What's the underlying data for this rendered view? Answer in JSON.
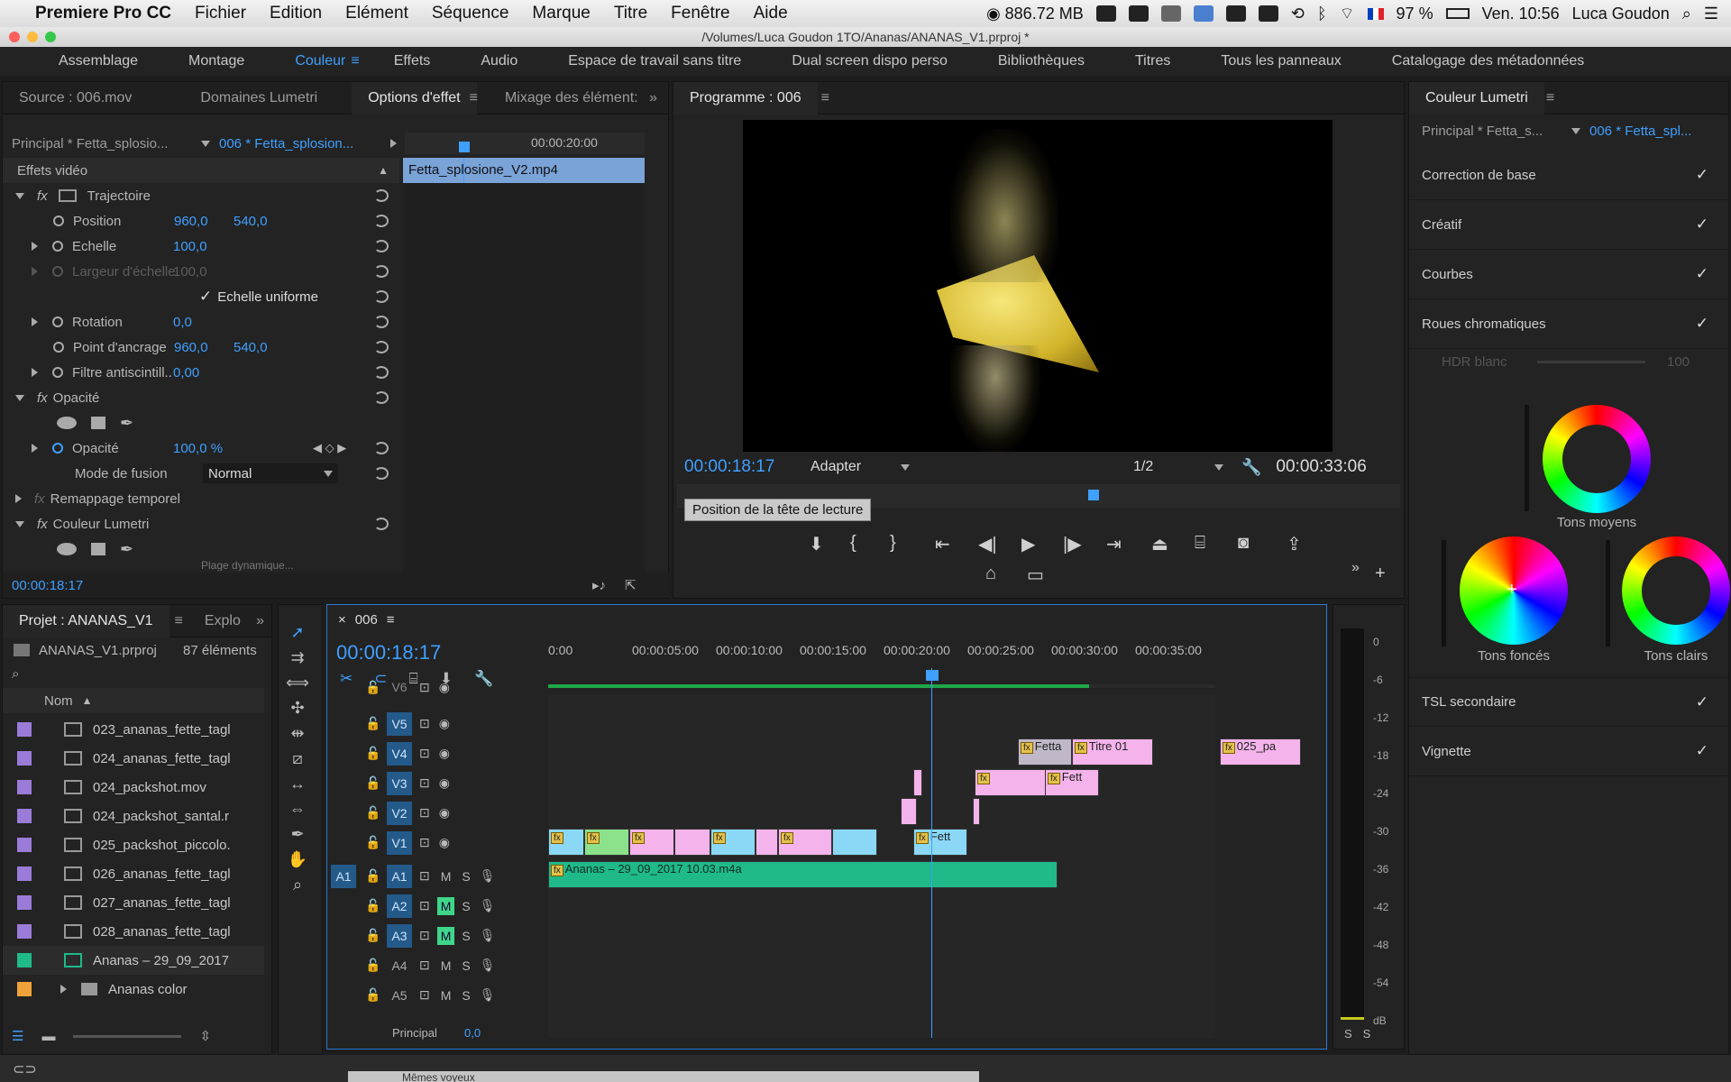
{
  "menubar": {
    "apple": "",
    "app": "Premiere Pro CC",
    "items": [
      "Fichier",
      "Edition",
      "Elément",
      "Séquence",
      "Marque",
      "Titre",
      "Fenêtre",
      "Aide"
    ],
    "memory": "886.72 MB",
    "battery": "97 %",
    "clock": "Ven. 10:56",
    "user": "Luca Goudon"
  },
  "window": {
    "title": "/Volumes/Luca Goudon 1TO/Ananas/ANANAS_V1.prproj *"
  },
  "workspaces": [
    "Assemblage",
    "Montage",
    "Couleur",
    "Effets",
    "Audio",
    "Espace de travail sans titre",
    "Dual screen dispo perso",
    "Bibliothèques",
    "Titres",
    "Tous les panneaux",
    "Catalogage des métadonnées"
  ],
  "effect_controls": {
    "tabs": [
      "Source : 006.mov",
      "Domaines Lumetri",
      "Options d'effet",
      "Mixage des élément:"
    ],
    "master": "Principal * Fetta_splosio...",
    "sequence": "006 * Fetta_splosion...",
    "ruler_time": "00:00:20:00",
    "clip_name": "Fetta_splosione_V2.mp4",
    "section": "Effets vidéo",
    "trajectoire": "Trajectoire",
    "position_label": "Position",
    "position_x": "960,0",
    "position_y": "540,0",
    "echelle_label": "Echelle",
    "echelle": "100,0",
    "largeur_label": "Largeur d'échelle",
    "largeur": "100,0",
    "uniforme": "Echelle uniforme",
    "rotation_label": "Rotation",
    "rotation": "0,0",
    "ancrage_label": "Point d'ancrage",
    "ancrage_x": "960,0",
    "ancrage_y": "540,0",
    "filtre_label": "Filtre antiscintill...",
    "filtre": "0,00",
    "opacite_section": "Opacité",
    "opacite_label": "Opacité",
    "opacite": "100,0 %",
    "fusion_label": "Mode de fusion",
    "fusion": "Normal",
    "remappage": "Remappage temporel",
    "lumetri": "Couleur Lumetri",
    "cut_text": "Plage dynamique...",
    "timecode": "00:00:18:17"
  },
  "program": {
    "title": "Programme : 006",
    "timecode": "00:00:18:17",
    "fit": "Adapter",
    "resolution": "1/2",
    "duration": "00:00:33:06",
    "tooltip": "Position de la tête de lecture"
  },
  "lumetri": {
    "title": "Couleur Lumetri",
    "master": "Principal * Fetta_s...",
    "sequence": "006 * Fetta_spl...",
    "sections": [
      "Correction de base",
      "Créatif",
      "Courbes",
      "Roues chromatiques"
    ],
    "hdr_label": "HDR blanc",
    "hdr_value": "100",
    "wheel_mid": "Tons moyens",
    "wheel_shadow": "Tons foncés",
    "wheel_high": "Tons clairs",
    "lower_sections": [
      "TSL secondaire",
      "Vignette"
    ]
  },
  "project": {
    "tabs": [
      "Projet : ANANAS_V1",
      "Explo"
    ],
    "file": "ANANAS_V1.prproj",
    "count": "87 éléments",
    "column": "Nom",
    "items": [
      {
        "name": "023_ananas_fette_tagl",
        "color": "#9b7bd8"
      },
      {
        "name": "024_ananas_fette_tagl",
        "color": "#9b7bd8"
      },
      {
        "name": "024_packshot.mov",
        "color": "#9b7bd8"
      },
      {
        "name": "024_packshot_santal.r",
        "color": "#9b7bd8"
      },
      {
        "name": "025_packshot_piccolo.",
        "color": "#9b7bd8"
      },
      {
        "name": "026_ananas_fette_tagl",
        "color": "#9b7bd8"
      },
      {
        "name": "027_ananas_fette_tagl",
        "color": "#9b7bd8"
      },
      {
        "name": "028_ananas_fette_tagl",
        "color": "#9b7bd8"
      },
      {
        "name": "Ananas – 29_09_2017",
        "color": "#1fb98a"
      },
      {
        "name": "Ananas color",
        "color": "#f0a23a"
      }
    ]
  },
  "timeline": {
    "tab": "006",
    "timecode": "00:00:18:17",
    "ruler": [
      "0:00",
      "00:00:05:00",
      "00:00:10:00",
      "00:00:15:00",
      "00:00:20:00",
      "00:00:25:00",
      "00:00:30:00",
      "00:00:35:00"
    ],
    "video_tracks": [
      "V6",
      "V5",
      "V4",
      "V3",
      "V2",
      "V1"
    ],
    "audio_tracks": [
      "A1",
      "A2",
      "A3",
      "A4",
      "A5"
    ],
    "source_a1": "A1",
    "audio_clip": "Ananas – 29_09_2017 10.03.m4a",
    "clip_v4a": "Fetta",
    "clip_v4b": "Titre 01",
    "clip_v4c": "025_pa",
    "clip_v3": "Fett",
    "clip_v1": "Fett",
    "master": "Principal",
    "master_val": "0,0",
    "m": "M",
    "s": "S"
  },
  "meter": {
    "scale": [
      "0",
      "-6",
      "-12",
      "-18",
      "-24",
      "-30",
      "-36",
      "-42",
      "-48",
      "-54",
      "dB"
    ],
    "solo": [
      "S",
      "S"
    ]
  },
  "footer": {
    "text": "Mêmes voyeux"
  }
}
